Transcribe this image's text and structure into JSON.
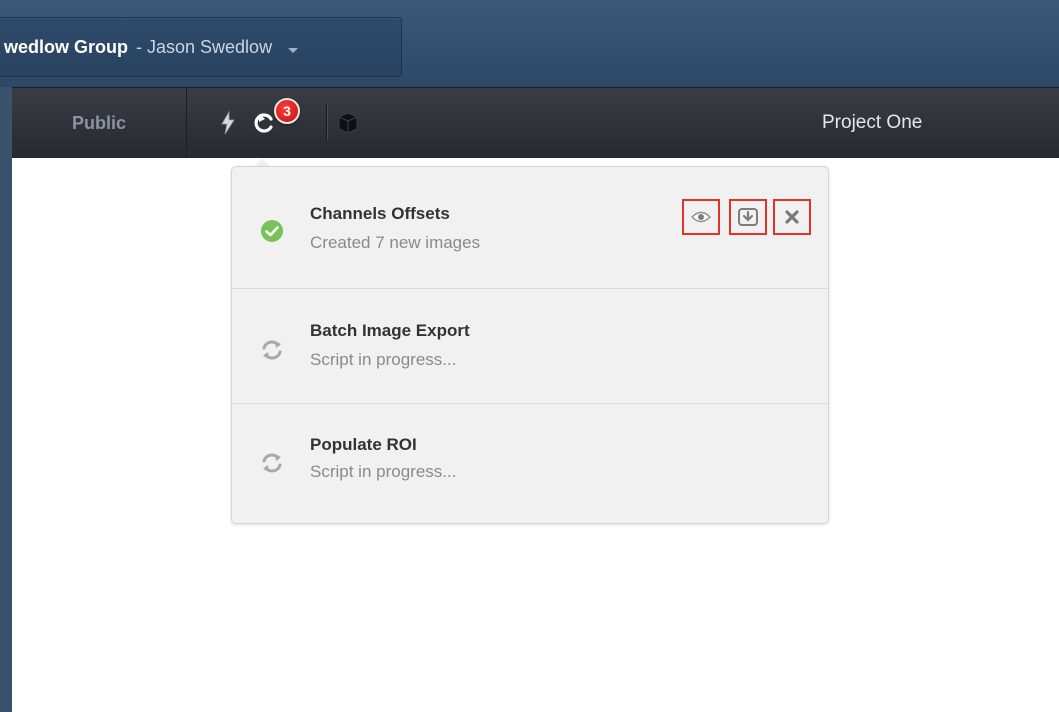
{
  "header": {
    "group_name": "wedlow Group",
    "group_user": "- Jason Swedlow"
  },
  "nav": {
    "public_label": "Public",
    "activities_badge_count": "3",
    "project_title": "Project One"
  },
  "activities": [
    {
      "title": "Channels Offsets",
      "message": "Created 7 new images",
      "status": "success",
      "icon": "check-circle-icon"
    },
    {
      "title": "Batch Image Export",
      "message": "Script in progress...",
      "status": "in-progress",
      "icon": "refresh-icon"
    },
    {
      "title": "Populate ROI",
      "message": "Script in progress...",
      "status": "in-progress",
      "icon": "refresh-icon"
    }
  ],
  "activity_actions": [
    "eye-icon",
    "download-icon",
    "close-icon"
  ],
  "colors": {
    "header_blue": "#2e4966",
    "nav_dark": "#262a30",
    "badge_red": "#d11a1a",
    "success_green": "#78c257",
    "highlight_red": "#e0332c"
  }
}
